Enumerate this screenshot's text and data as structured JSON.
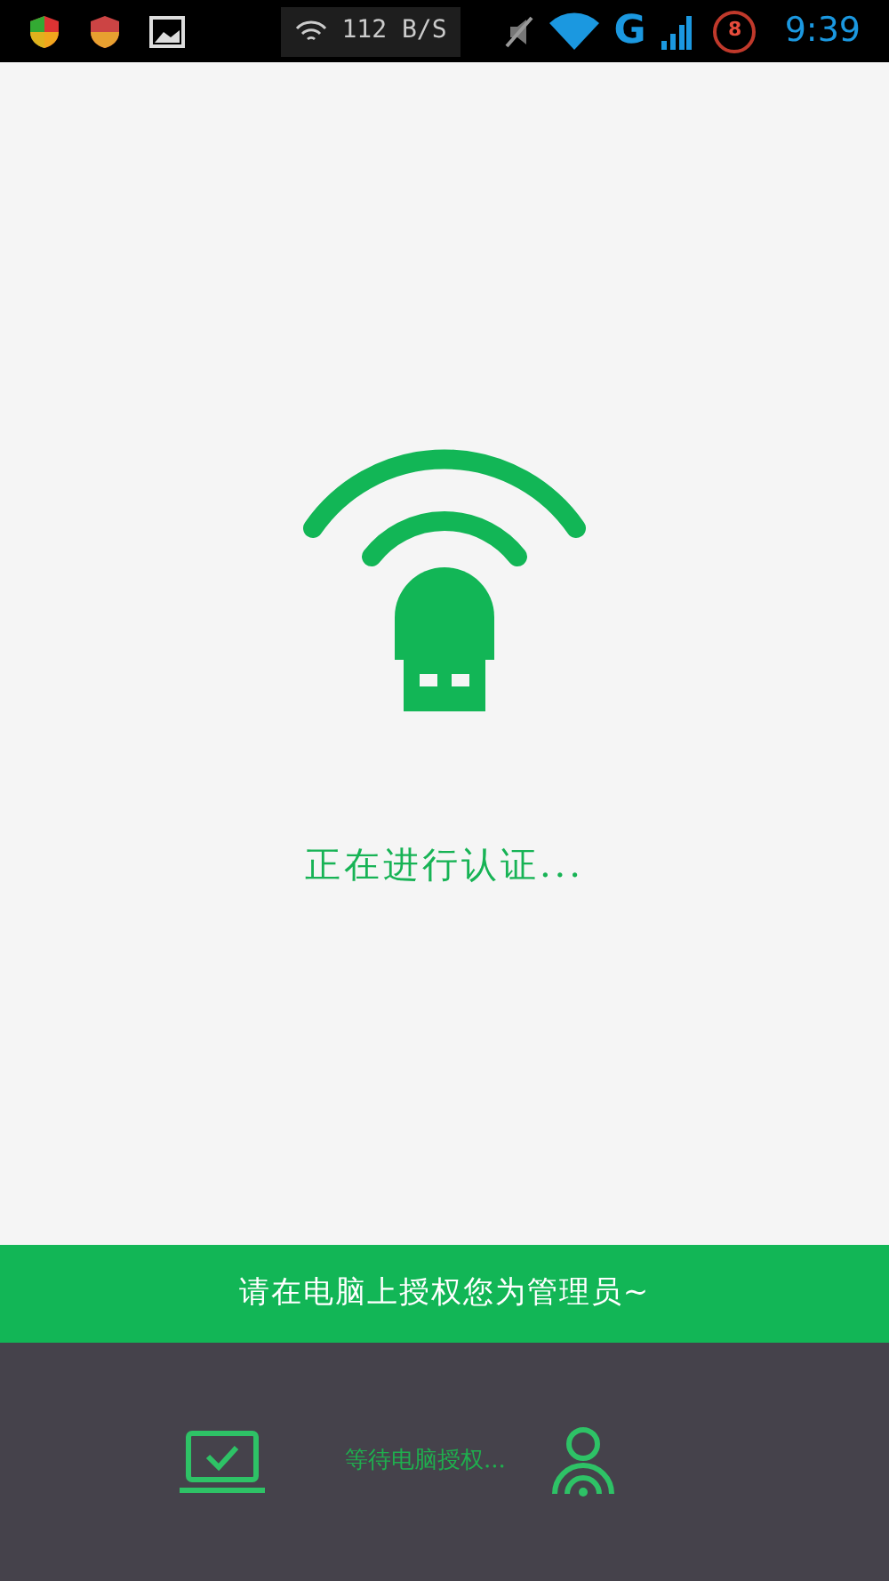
{
  "status_bar": {
    "speed": "112 B/S",
    "network": "G",
    "battery": "8",
    "time": "9:39"
  },
  "main": {
    "status_text": "正在进行认证..."
  },
  "banner": {
    "text": "请在电脑上授权您为管理员~"
  },
  "footer": {
    "waiting_text": "等待电脑授权..."
  }
}
